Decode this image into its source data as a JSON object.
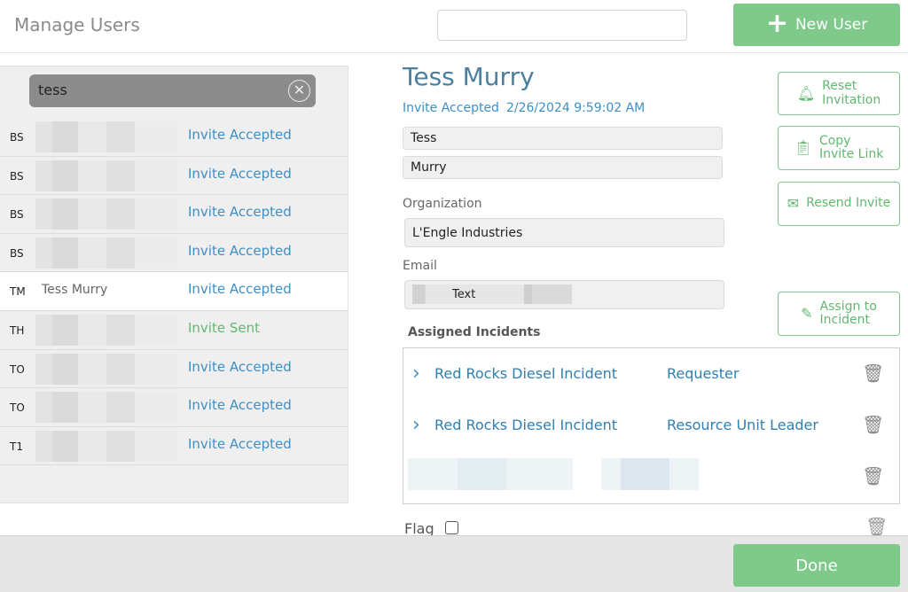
{
  "header": {
    "title": "Manage Users",
    "search_value": "",
    "new_user_label": "New User",
    "new_user_icon": "plus-icon"
  },
  "filter": {
    "value": "tess",
    "clear_icon": "clear-circle-icon"
  },
  "users": [
    {
      "initials": "BS",
      "name": "",
      "status": "Invite Accepted"
    },
    {
      "initials": "BS",
      "name": "",
      "status": "Invite Accepted"
    },
    {
      "initials": "BS",
      "name": "",
      "status": "Invite Accepted"
    },
    {
      "initials": "BS",
      "name": "",
      "status": "Invite Accepted"
    },
    {
      "initials": "TM",
      "name": "Tess Murry",
      "status": "Invite Accepted"
    },
    {
      "initials": "TH",
      "name": "",
      "status": "Invite Sent"
    },
    {
      "initials": "TO",
      "name": "",
      "status": "Invite Accepted"
    },
    {
      "initials": "TO",
      "name": "",
      "status": "Invite Accepted"
    },
    {
      "initials": "T1",
      "name": "",
      "status": "Invite Accepted"
    }
  ],
  "detail": {
    "full_name": "Tess Murry",
    "invite_status": "Invite Accepted",
    "invite_date": "2/26/2024 9:59:02 AM",
    "first_name": "Tess",
    "last_name": "Murry",
    "organization_label": "Organization",
    "organization": "L'Engle Industries",
    "email_label": "Email",
    "email": "Text"
  },
  "actions": {
    "reset_line1": "Reset",
    "reset_line2": "Invitation",
    "copy_line1": "Copy",
    "copy_line2": "Invite Link",
    "resend": "Resend Invite",
    "assign_line1": "Assign to",
    "assign_line2": "Incident"
  },
  "incidents": {
    "title": "Assigned Incidents",
    "rows": [
      {
        "name": "Red Rocks Diesel Incident",
        "role": "Requester"
      },
      {
        "name": "Red Rocks Diesel Incident",
        "role": "Resource Unit Leader"
      }
    ]
  },
  "flag": {
    "label": "Flag",
    "checked": false
  },
  "footer": {
    "done_label": "Done"
  },
  "colors": {
    "accent_green": "#7fc98a",
    "link_blue": "#3d8fc6",
    "name_blue": "#4a7fa0"
  }
}
